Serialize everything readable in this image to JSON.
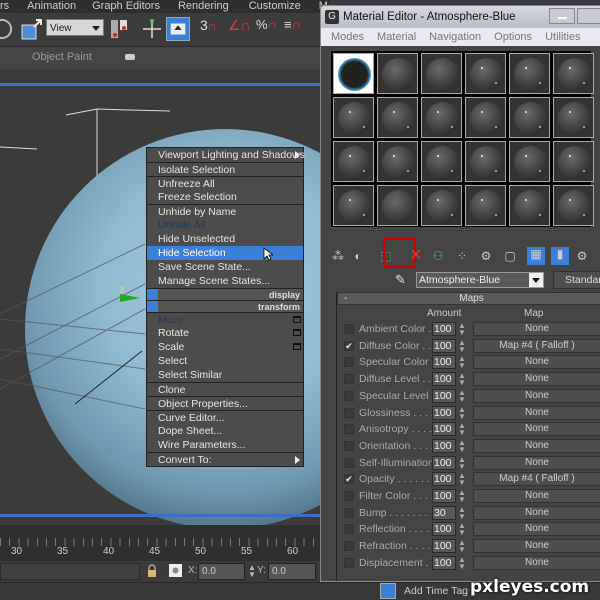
{
  "app": {
    "menu": [
      "rs",
      "Animation",
      "Graph Editors",
      "Rendering",
      "Customize",
      "MAXS"
    ],
    "toolbar": {
      "view_select": "View",
      "snap_labels": [
        "3",
        "%"
      ]
    },
    "ribbon": {
      "label": "Object Paint"
    }
  },
  "context_menu": {
    "items": [
      {
        "label": "Viewport Lighting and Shadows",
        "submenu": true
      },
      {
        "label": "Isolate Selection"
      },
      {
        "label": "Unfreeze All"
      },
      {
        "label": "Freeze Selection"
      },
      {
        "label": "Unhide by Name"
      },
      {
        "label": "Unhide All",
        "disabled": true
      },
      {
        "label": "Hide Unselected"
      },
      {
        "label": "Hide Selection",
        "selected": true
      },
      {
        "label": "Save Scene State..."
      },
      {
        "label": "Manage Scene States..."
      }
    ],
    "quad_labels": [
      "display",
      "transform"
    ],
    "transform_items": [
      {
        "label": "Move",
        "disabled": true
      },
      {
        "label": "Rotate"
      },
      {
        "label": "Scale"
      },
      {
        "label": "Select"
      },
      {
        "label": "Select Similar"
      },
      {
        "label": "Clone"
      },
      {
        "label": "Object Properties..."
      },
      {
        "label": "Curve Editor..."
      },
      {
        "label": "Dope Sheet..."
      },
      {
        "label": "Wire Parameters..."
      },
      {
        "label": "Convert To:",
        "submenu": true
      }
    ]
  },
  "timeline": {
    "ticks": [
      "30",
      "35",
      "40",
      "45",
      "50",
      "55",
      "60"
    ]
  },
  "status": {
    "x_label": "X:",
    "x_value": "0.0",
    "y_label": "Y:",
    "y_value": "0.0",
    "add_time_tag": "Add Time Tag"
  },
  "material_editor": {
    "title": "Material Editor - Atmosphere-Blue",
    "menu": [
      "Modes",
      "Material",
      "Navigation",
      "Options",
      "Utilities"
    ],
    "slot_count": 24,
    "active_slot": 0,
    "material_name": "Atmosphere-Blue",
    "material_type": "Standard",
    "maps_header": "Maps",
    "col_amount": "Amount",
    "col_map": "Map",
    "maps": [
      {
        "name": "Ambient Color . .",
        "checked": false,
        "amount": "100",
        "map": "None"
      },
      {
        "name": "Diffuse Color . . .",
        "checked": true,
        "amount": "100",
        "map": "Map #4  ( Falloff )"
      },
      {
        "name": "Specular Color  .",
        "checked": false,
        "amount": "100",
        "map": "None"
      },
      {
        "name": "Diffuse Level . . .",
        "checked": false,
        "amount": "100",
        "map": "None"
      },
      {
        "name": "Specular Level  .",
        "checked": false,
        "amount": "100",
        "map": "None"
      },
      {
        "name": "Glossiness  . . . .",
        "checked": false,
        "amount": "100",
        "map": "None"
      },
      {
        "name": "Anisotropy  . . . .",
        "checked": false,
        "amount": "100",
        "map": "None"
      },
      {
        "name": "Orientation . . . .",
        "checked": false,
        "amount": "100",
        "map": "None"
      },
      {
        "name": "Self-Illumination .",
        "checked": false,
        "amount": "100",
        "map": "None"
      },
      {
        "name": "Opacity . . . . . .",
        "checked": true,
        "amount": "100",
        "map": "Map #4  ( Falloff )"
      },
      {
        "name": "Filter Color  . . . .",
        "checked": false,
        "amount": "100",
        "map": "None"
      },
      {
        "name": "Bump  . . . . . . .",
        "checked": false,
        "amount": "30",
        "map": "None"
      },
      {
        "name": "Reflection  . . . .",
        "checked": false,
        "amount": "100",
        "map": "None"
      },
      {
        "name": "Refraction  . . . .",
        "checked": false,
        "amount": "100",
        "map": "None"
      },
      {
        "name": "Displacement . . .",
        "checked": false,
        "amount": "100",
        "map": "None"
      }
    ]
  },
  "watermark": "pxleyes.com",
  "colors": {
    "accent": "#3b7fd6",
    "highlight_box": "#cc0000"
  }
}
